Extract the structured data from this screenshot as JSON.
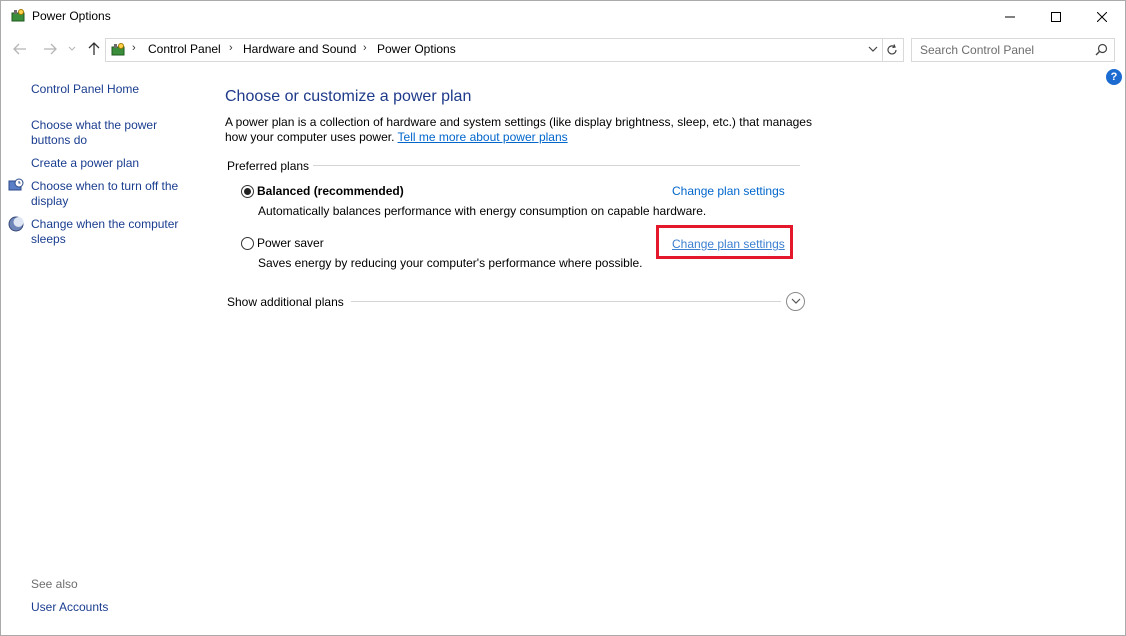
{
  "window": {
    "title": "Power Options"
  },
  "navigation": {
    "breadcrumbs": [
      "Control Panel",
      "Hardware and Sound",
      "Power Options"
    ],
    "search_placeholder": "Search Control Panel"
  },
  "help": {
    "label": "?"
  },
  "sidebar": {
    "home": "Control Panel Home",
    "items": [
      {
        "label_line1": "Choose what the power",
        "label_line2": "buttons do",
        "icon": ""
      },
      {
        "label_line1": "Create a power plan",
        "label_line2": "",
        "icon": ""
      },
      {
        "label_line1": "Choose when to turn off the",
        "label_line2": "display",
        "icon": "display-clock-icon"
      },
      {
        "label_line1": "Change when the computer",
        "label_line2": "sleeps",
        "icon": "moon-sleep-icon"
      }
    ],
    "see_also": "See also",
    "user_accounts": "User Accounts"
  },
  "main": {
    "title": "Choose or customize a power plan",
    "description": "A power plan is a collection of hardware and system settings (like display brightness, sleep, etc.) that manages how your computer uses power.",
    "more_link": "Tell me more about power plans",
    "preferred_label": "Preferred plans",
    "plans": [
      {
        "name": "Balanced (recommended)",
        "description": "Automatically balances performance with energy consumption on capable hardware.",
        "link": "Change plan settings",
        "selected": true
      },
      {
        "name": "Power saver",
        "description": "Saves energy by reducing your computer's performance where possible.",
        "link": "Change plan settings",
        "selected": false
      }
    ],
    "additional_plans": "Show additional plans"
  },
  "colors": {
    "link": "#1a3d8f",
    "title": "#1e3a8a",
    "highlight": "#e3192b"
  }
}
